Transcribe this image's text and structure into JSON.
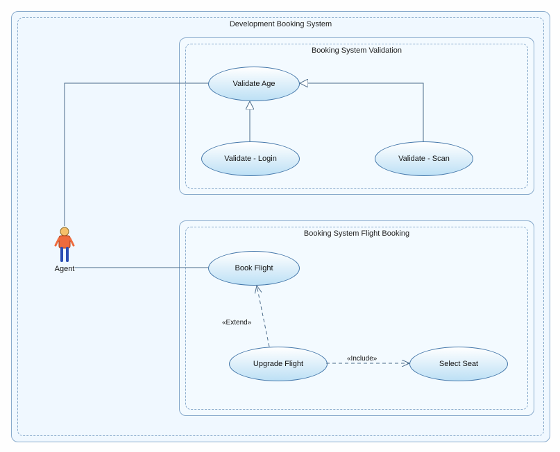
{
  "diagram": {
    "title": "Development Booking System",
    "boundaries": {
      "validation": {
        "title": "Booking System Validation"
      },
      "flight": {
        "title": "Booking System Flight Booking"
      }
    },
    "actors": {
      "agent": {
        "label": "Agent"
      }
    },
    "usecases": {
      "validateAge": {
        "label": "Validate Age"
      },
      "validateLogin": {
        "label": "Validate - Login"
      },
      "validateScan": {
        "label": "Validate - Scan"
      },
      "bookFlight": {
        "label": "Book Flight"
      },
      "upgradeFlight": {
        "label": "Upgrade Flight"
      },
      "selectSeat": {
        "label": "Select Seat"
      }
    },
    "relations": {
      "extend": {
        "label": "«Extend»"
      },
      "include": {
        "label": "«Include»"
      }
    }
  },
  "chart_data": {
    "type": "UML Use Case Diagram",
    "system": "Development Booking System",
    "subsystems": [
      {
        "name": "Booking System Validation",
        "usecases": [
          "Validate Age",
          "Validate - Login",
          "Validate - Scan"
        ]
      },
      {
        "name": "Booking System Flight Booking",
        "usecases": [
          "Book Flight",
          "Upgrade Flight",
          "Select Seat"
        ]
      }
    ],
    "actors": [
      "Agent"
    ],
    "relationships": [
      {
        "from": "Agent",
        "to": "Validate Age",
        "type": "association"
      },
      {
        "from": "Agent",
        "to": "Book Flight",
        "type": "association"
      },
      {
        "from": "Validate - Login",
        "to": "Validate Age",
        "type": "generalization"
      },
      {
        "from": "Validate - Scan",
        "to": "Validate Age",
        "type": "generalization"
      },
      {
        "from": "Upgrade Flight",
        "to": "Book Flight",
        "type": "extend"
      },
      {
        "from": "Upgrade Flight",
        "to": "Select Seat",
        "type": "include"
      }
    ]
  }
}
